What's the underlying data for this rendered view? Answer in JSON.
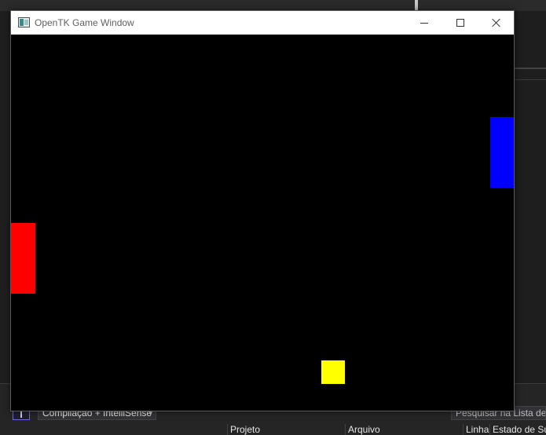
{
  "window": {
    "title": "OpenTK Game Window",
    "controls": [
      "minimize",
      "maximize",
      "close"
    ]
  },
  "game": {
    "background_color": "#000000",
    "left_paddle": {
      "color": "#ff0000"
    },
    "right_paddle": {
      "color": "#0000ff"
    },
    "ball": {
      "color": "#ffff00"
    }
  },
  "ide": {
    "scope_dropdown": "Compilação + IntelliSense",
    "search_placeholder": "Pesquisar na Lista de Erros",
    "columns": [
      "Projeto",
      "Arquivo",
      "Linha",
      "Estado de Supressão"
    ]
  },
  "icons": {
    "app": "app-icon",
    "filter": "filter-icon",
    "minimize": "minimize-icon",
    "maximize": "maximize-icon",
    "close": "close-icon",
    "dropdown": "chevron-down-icon"
  }
}
